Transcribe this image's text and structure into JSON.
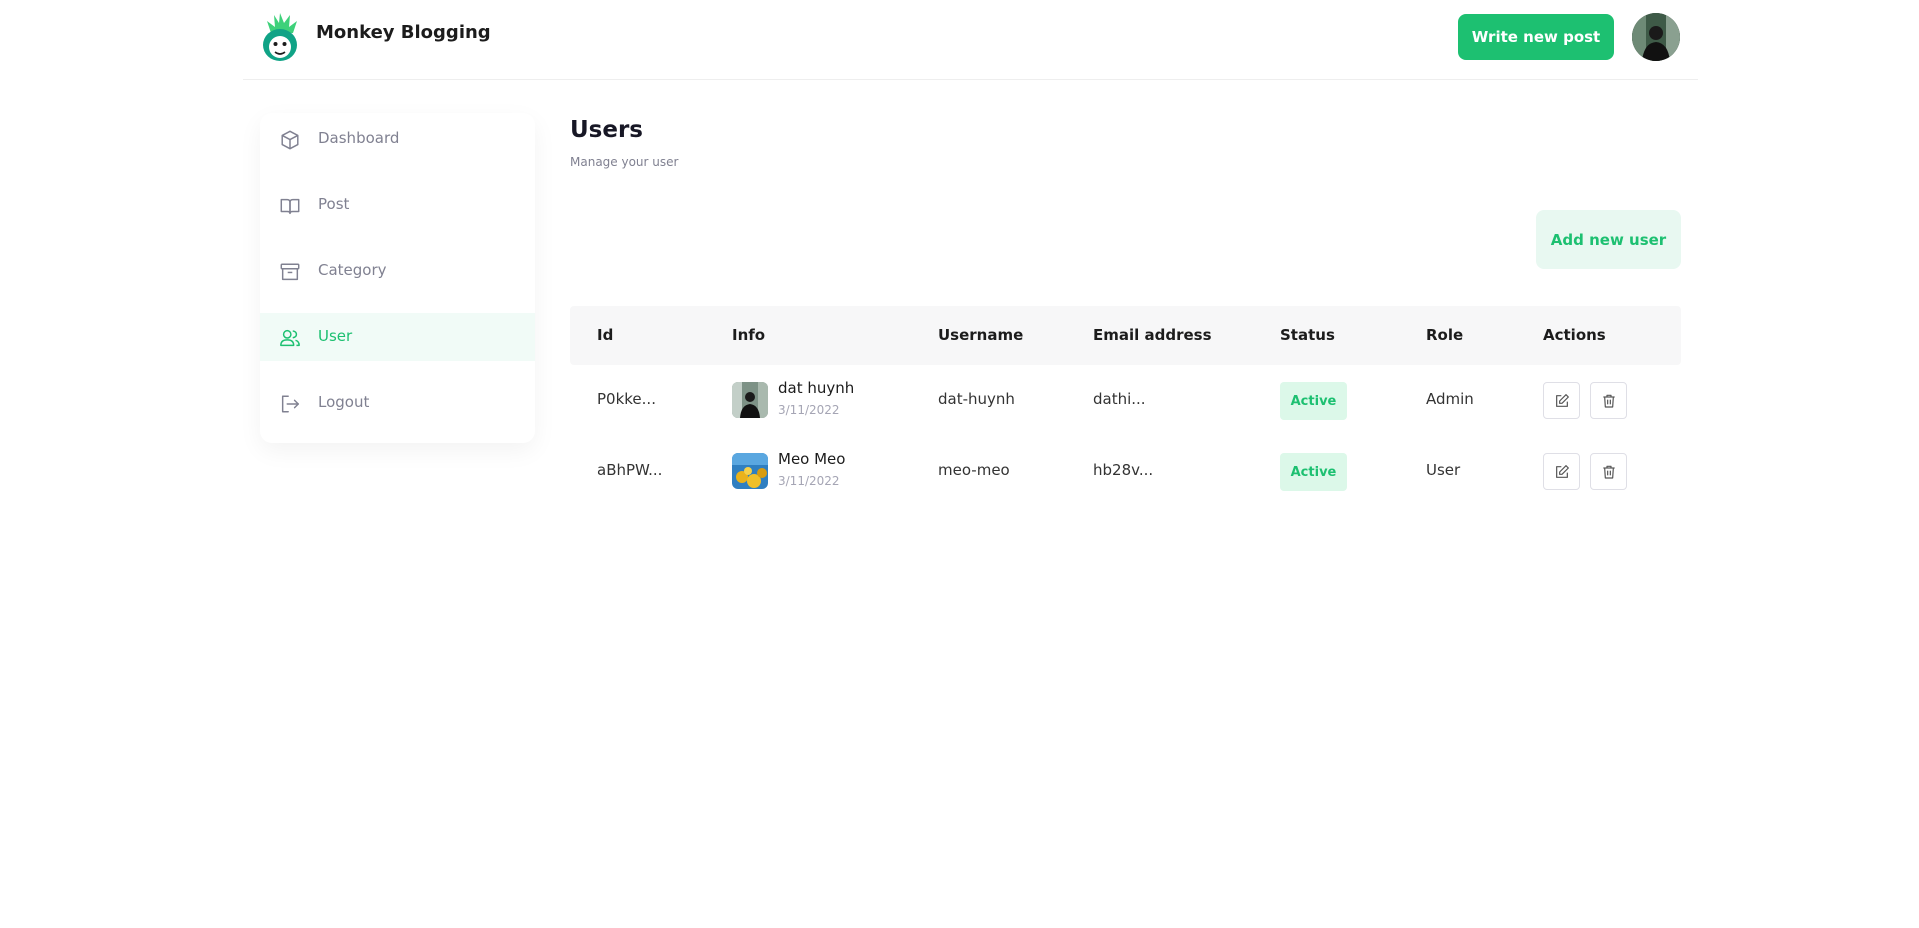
{
  "header": {
    "brand": "Monkey Blogging",
    "write_button": "Write new post"
  },
  "sidebar": {
    "items": [
      {
        "label": "Dashboard",
        "icon": "cube-icon"
      },
      {
        "label": "Post",
        "icon": "book-icon"
      },
      {
        "label": "Category",
        "icon": "archive-icon"
      },
      {
        "label": "User",
        "icon": "users-icon",
        "active": true
      },
      {
        "label": "Logout",
        "icon": "logout-icon"
      }
    ]
  },
  "main": {
    "title": "Users",
    "subtitle": "Manage your user",
    "add_button": "Add new user"
  },
  "table": {
    "headers": [
      "Id",
      "Info",
      "Username",
      "Email address",
      "Status",
      "Role",
      "Actions"
    ],
    "rows": [
      {
        "id": "P0kke...",
        "name": "dat huynh",
        "date": "3/11/2022",
        "username": "dat-huynh",
        "email": "dathi...",
        "status": "Active",
        "role": "Admin"
      },
      {
        "id": "aBhPW...",
        "name": "Meo Meo",
        "date": "3/11/2022",
        "username": "meo-meo",
        "email": "hb28v...",
        "status": "Active",
        "role": "User"
      }
    ]
  },
  "colors": {
    "accent": "#1dc071",
    "accent_light": "#e8f8f1",
    "muted_text": "#808191"
  }
}
